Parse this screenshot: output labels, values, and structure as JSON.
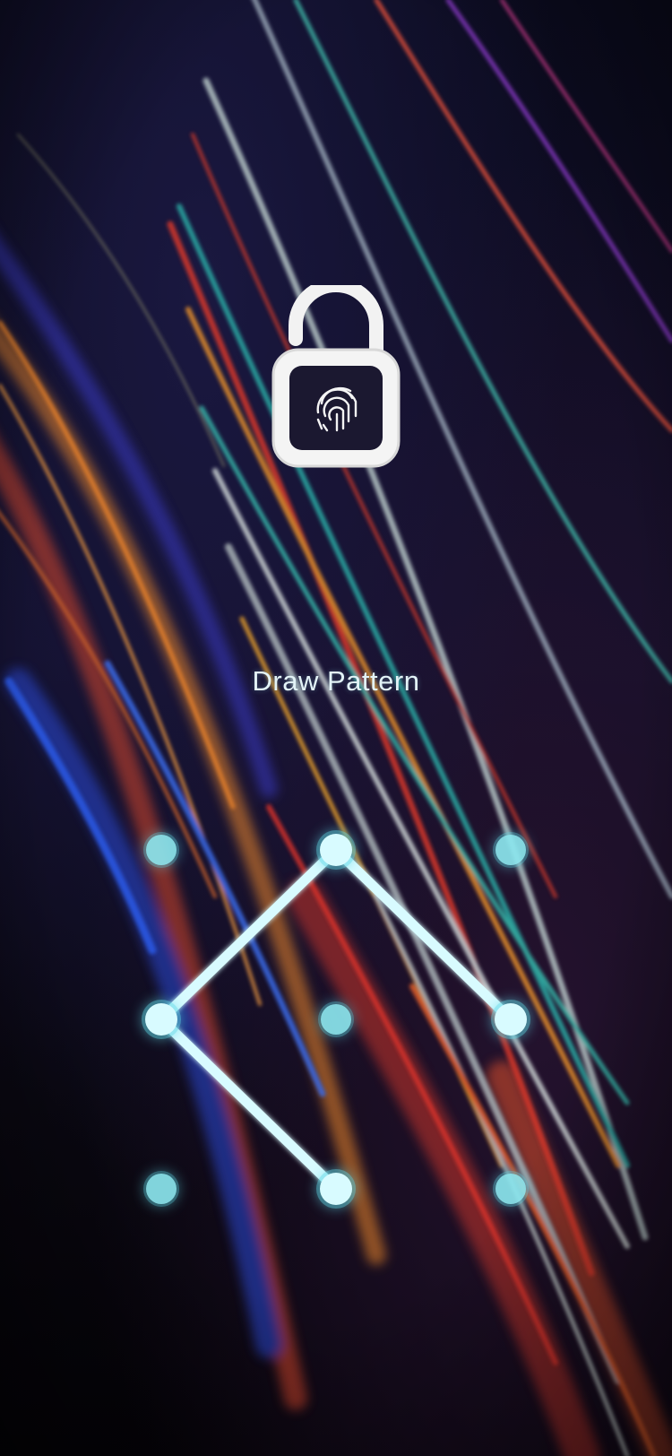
{
  "lock_screen": {
    "icon": "padlock-open-fingerprint-icon",
    "prompt": "Draw Pattern"
  },
  "pattern": {
    "grid_rows": 3,
    "grid_cols": 3,
    "dots": [
      {
        "row": 0,
        "col": 0,
        "active": false
      },
      {
        "row": 0,
        "col": 1,
        "active": true
      },
      {
        "row": 0,
        "col": 2,
        "active": false
      },
      {
        "row": 1,
        "col": 0,
        "active": true
      },
      {
        "row": 1,
        "col": 1,
        "active": false
      },
      {
        "row": 1,
        "col": 2,
        "active": true
      },
      {
        "row": 2,
        "col": 0,
        "active": false
      },
      {
        "row": 2,
        "col": 1,
        "active": true
      },
      {
        "row": 2,
        "col": 2,
        "active": false
      }
    ],
    "path": [
      {
        "row": 1,
        "col": 2
      },
      {
        "row": 0,
        "col": 1
      },
      {
        "row": 1,
        "col": 0
      },
      {
        "row": 2,
        "col": 1
      }
    ]
  },
  "colors": {
    "accent": "#d8fbff",
    "dot_inactive": "#8fe7ef",
    "dot_glow": "#5fd8e6",
    "icon": "#f4f4f4"
  }
}
